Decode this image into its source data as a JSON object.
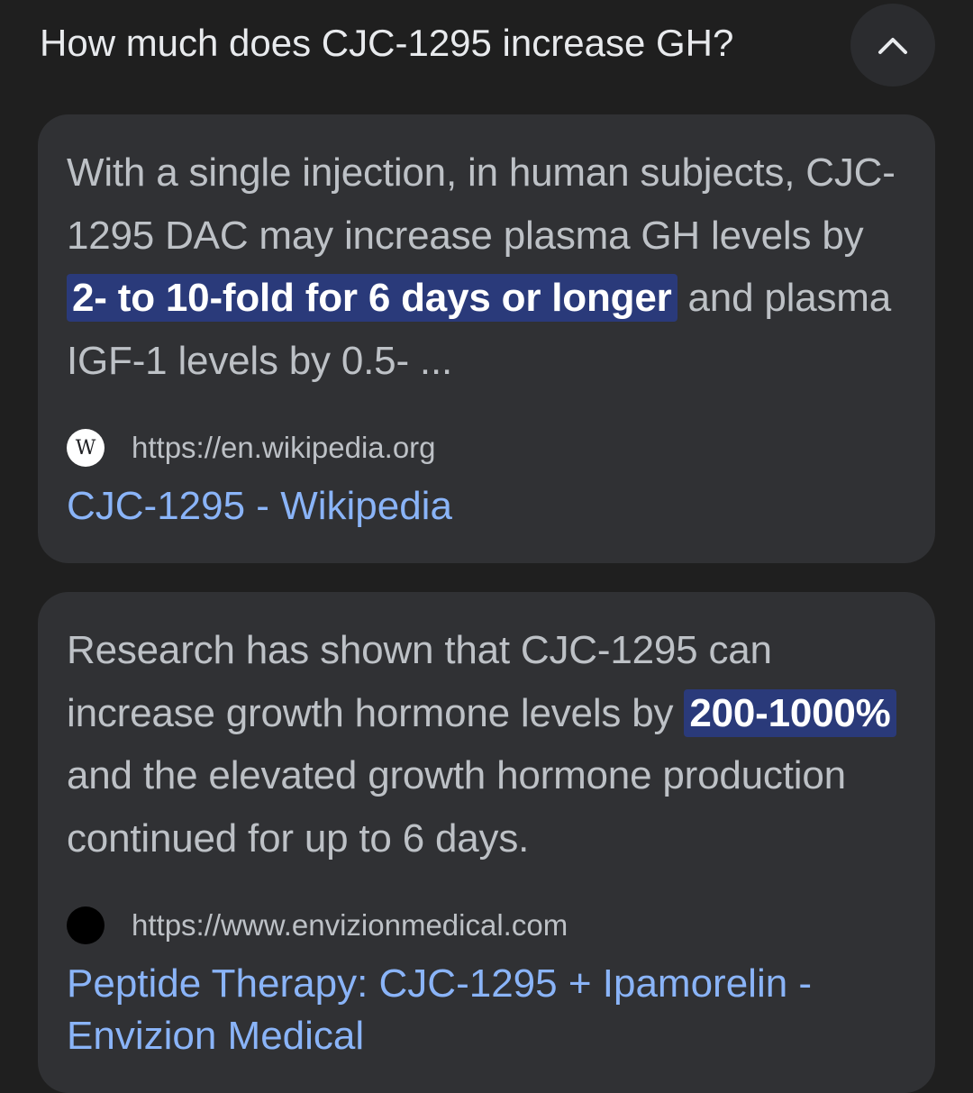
{
  "header": {
    "question": "How much does CJC-1295 increase GH?",
    "collapse_icon": "chevron-up-icon"
  },
  "results": [
    {
      "snippet_before": "With a single injection, in human subjects, CJC-1295 DAC may increase plasma GH levels by ",
      "snippet_highlight": "2- to 10-fold for 6 days or longer",
      "snippet_after": " and plasma IGF-1 levels by 0.5- ...",
      "favicon_letter": "W",
      "url": "https://en.wikipedia.org",
      "title": "CJC-1295 - Wikipedia"
    },
    {
      "snippet_before": "Research has shown that CJC-1295 can increase growth hormone levels by ",
      "snippet_highlight": "200-1000%",
      "snippet_after": " and the elevated growth hormone production continued for up to 6 days.",
      "favicon_icon": "black-circle-icon",
      "url": "https://www.envizionmedical.com",
      "title": "Peptide Therapy: CJC-1295 + Ipamorelin - Envizion Medical"
    }
  ],
  "colors": {
    "background": "#1f1f1f",
    "card": "#303134",
    "link": "#8ab4f8",
    "highlight": "#2a3a7a"
  }
}
